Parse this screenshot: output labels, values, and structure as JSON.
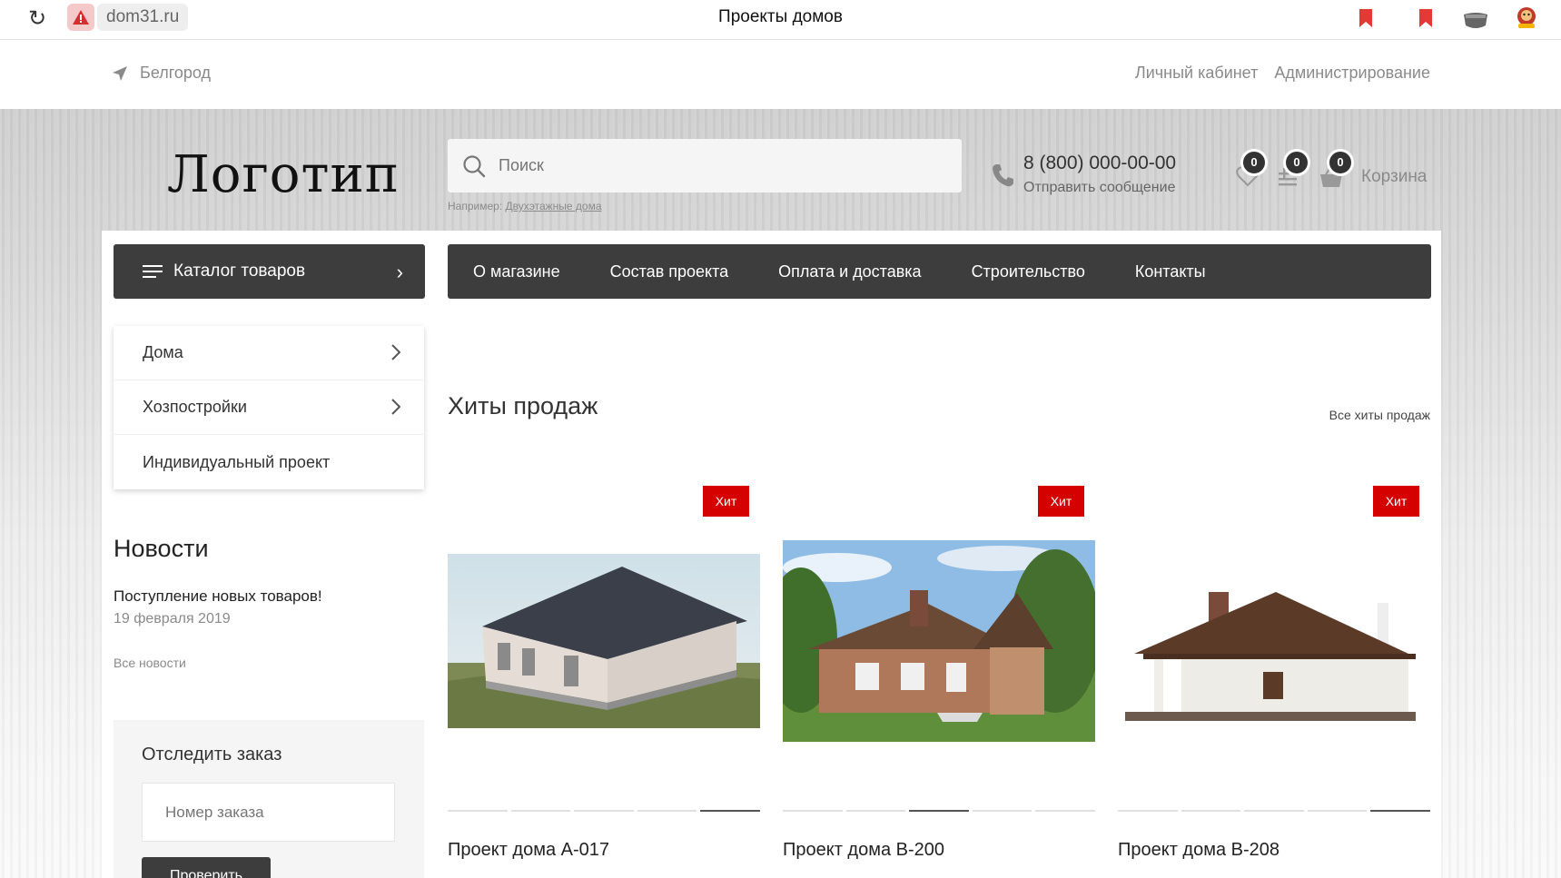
{
  "browser": {
    "url": "dom31.ru",
    "tab_title": "Проекты домов"
  },
  "top": {
    "city": "Белгород",
    "links": [
      "Личный кабинет",
      "Администрирование"
    ]
  },
  "header": {
    "logo": "Логотип",
    "search_placeholder": "Поиск",
    "search_hint_prefix": "Например:",
    "search_hint_example": "Двухэтажные дома",
    "phone": "8 (800) 000-00-00",
    "send_message": "Отправить сообщение",
    "counters": {
      "favorites": "0",
      "compare": "0",
      "cart": "0"
    },
    "cart_label": "Корзина"
  },
  "nav": {
    "catalog_label": "Каталог товаров",
    "menu": [
      "О магазине",
      "Состав проекта",
      "Оплата и доставка",
      "Строительство",
      "Контакты"
    ]
  },
  "sidebar": {
    "items": [
      {
        "label": "Дома",
        "has_children": true
      },
      {
        "label": "Хозпостройки",
        "has_children": true
      },
      {
        "label": "Индивидуальный проект",
        "has_children": false
      }
    ]
  },
  "news": {
    "title": "Новости",
    "item_title": "Поступление новых товаров!",
    "item_date": "19 февраля 2019",
    "all_link": "Все новости"
  },
  "track": {
    "title": "Отследить заказ",
    "placeholder": "Номер заказа",
    "button": "Проверить"
  },
  "hits": {
    "title": "Хиты продаж",
    "all_link": "Все хиты продаж",
    "badge": "Хит",
    "products": [
      {
        "name": "Проект дома А-017",
        "active_dot": 4
      },
      {
        "name": "Проект дома В-200",
        "active_dot": 2
      },
      {
        "name": "Проект дома В-208",
        "active_dot": 4
      }
    ]
  },
  "colors": {
    "accent": "#d50000",
    "dark": "#3d3d3d"
  }
}
